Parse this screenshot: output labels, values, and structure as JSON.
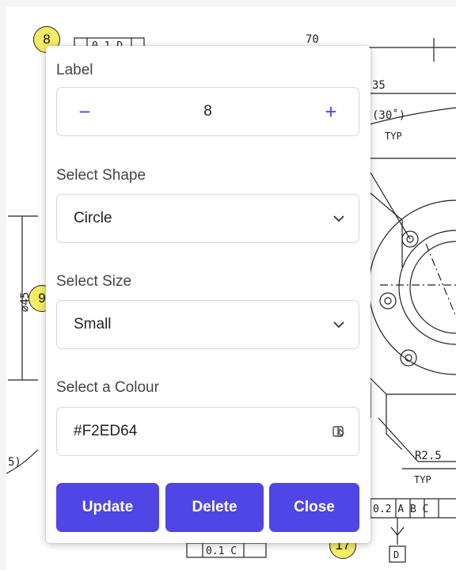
{
  "drawing": {
    "texts": {
      "dim_70": "70",
      "dim_35": "35",
      "dim_30": "(30˚)",
      "typ_top": "TYP",
      "dia_45": "⌀45",
      "r25": "R2.5",
      "typ_bottom": "TYP",
      "left_arc": "5)",
      "fcf_top": "0.1 D",
      "fcf_bottom": "0.1 C",
      "fcf_right": "0.2 A B C",
      "datum_d": "D"
    },
    "balloons": {
      "b8": "8",
      "b9": "9",
      "b17": "17"
    },
    "balloon_color": "#F2ED64"
  },
  "panel": {
    "label_title": "Label",
    "label_value": "8",
    "minus_symbol": "−",
    "plus_symbol": "+",
    "shape_title": "Select Shape",
    "shape_value": "Circle",
    "size_title": "Select Size",
    "size_value": "Small",
    "colour_title": "Select a Colour",
    "colour_value": "#F2ED64",
    "buttons": {
      "update": "Update",
      "delete": "Delete",
      "close": "Close"
    },
    "accent_color": "#4f46e5"
  }
}
